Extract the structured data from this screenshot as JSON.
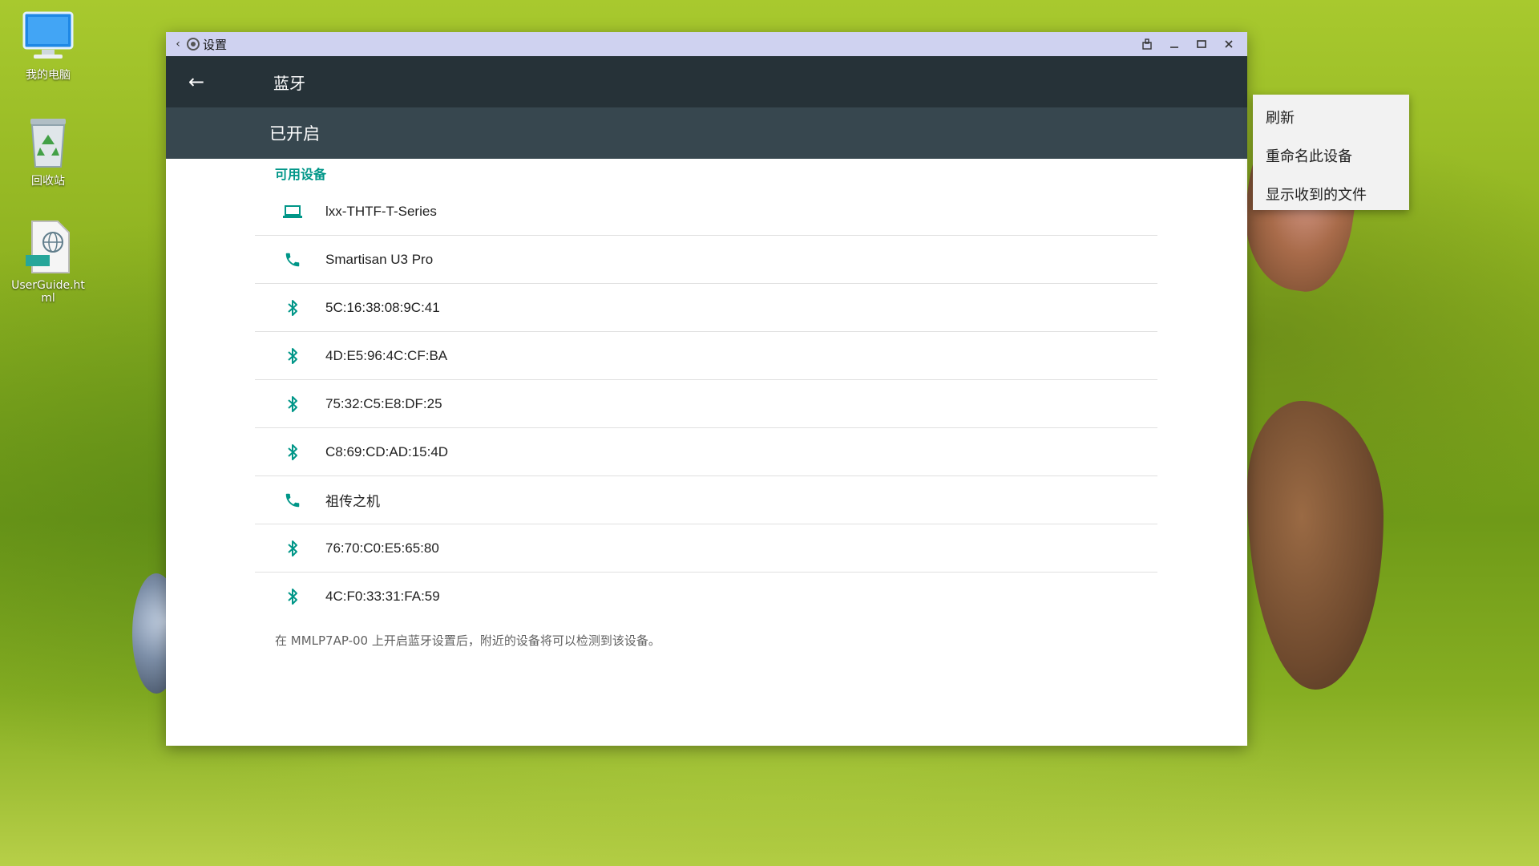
{
  "desktop": {
    "icons": [
      {
        "label": "我的电脑",
        "icon": "computer-icon"
      },
      {
        "label": "回收站",
        "icon": "recycle-bin-icon"
      },
      {
        "label": "UserGuide.html",
        "icon": "html-file-icon",
        "badge": "HTML"
      }
    ]
  },
  "window": {
    "title": "设置",
    "controls": [
      "pin-icon",
      "minimize-icon",
      "maximize-icon",
      "close-icon"
    ]
  },
  "appbar": {
    "title": "蓝牙"
  },
  "switchbar": {
    "label": "已开启"
  },
  "content": {
    "section_header": "可用设备",
    "devices": [
      {
        "name": "lxx-THTF-T-Series",
        "icon": "laptop-icon"
      },
      {
        "name": "Smartisan U3 Pro",
        "icon": "phone-icon"
      },
      {
        "name": "5C:16:38:08:9C:41",
        "icon": "bluetooth-icon"
      },
      {
        "name": "4D:E5:96:4C:CF:BA",
        "icon": "bluetooth-icon"
      },
      {
        "name": "75:32:C5:E8:DF:25",
        "icon": "bluetooth-icon"
      },
      {
        "name": "C8:69:CD:AD:15:4D",
        "icon": "bluetooth-icon"
      },
      {
        "name": "祖传之机",
        "icon": "phone-icon"
      },
      {
        "name": "76:70:C0:E5:65:80",
        "icon": "bluetooth-icon"
      },
      {
        "name": "4C:F0:33:31:FA:59",
        "icon": "bluetooth-icon"
      }
    ],
    "footer_note": "在 MMLP7AP-00 上开启蓝牙设置后，附近的设备将可以检测到该设备。"
  },
  "menu": {
    "items": [
      "刷新",
      "重命名此设备",
      "显示收到的文件"
    ]
  },
  "colors": {
    "accent": "#009688",
    "appbar": "#263238",
    "switchbar": "#37474f",
    "titlebar": "#cfd2f0"
  }
}
